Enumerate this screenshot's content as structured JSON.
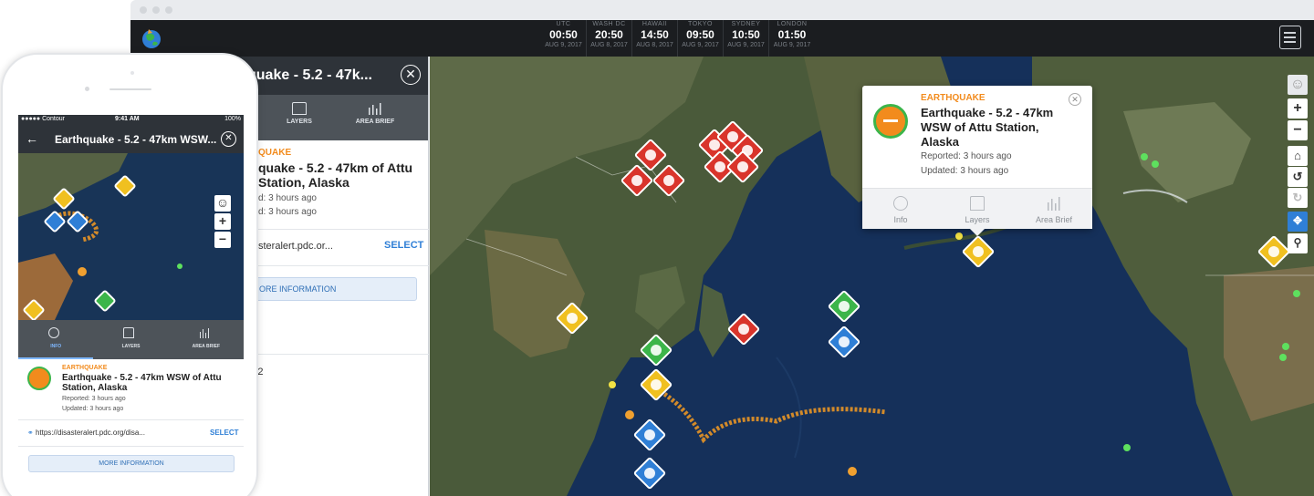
{
  "window": {
    "time_zones": [
      {
        "zone": "UTC",
        "time": "00:50",
        "date": "AUG 9, 2017"
      },
      {
        "zone": "WASH DC",
        "time": "20:50",
        "date": "AUG 8, 2017"
      },
      {
        "zone": "HAWAII",
        "time": "14:50",
        "date": "AUG 8, 2017"
      },
      {
        "zone": "TOKYO",
        "time": "09:50",
        "date": "AUG 9, 2017"
      },
      {
        "zone": "SYDNEY",
        "time": "10:50",
        "date": "AUG 9, 2017"
      },
      {
        "zone": "LONDON",
        "time": "01:50",
        "date": "AUG 9, 2017"
      }
    ]
  },
  "side_panel": {
    "title": "quake - 5.2 - 47k...",
    "tabs": [
      "LAYERS",
      "AREA BRIEF"
    ],
    "category": "QUAKE",
    "event_title": "quake - 5.2 - 47km of Attu Station, Alaska",
    "reported": "d: 3 hours ago",
    "updated": "d: 3 hours ago",
    "url": "steralert.pdc.or...",
    "select_label": "SELECT",
    "more_label": "ORE INFORMATION",
    "extra": "P2"
  },
  "popup": {
    "category": "EARTHQUAKE",
    "title": "Earthquake - 5.2 - 47km WSW of Attu Station, Alaska",
    "reported": "Reported: 3 hours ago",
    "updated": "Updated: 3 hours ago",
    "tabs": [
      "Info",
      "Layers",
      "Area Brief"
    ]
  },
  "map_controls": [
    "person-icon",
    "zoom-in",
    "zoom-out",
    "home-icon",
    "rotate-icon",
    "refresh-icon",
    "pan-icon",
    "search-zoom-icon"
  ],
  "phone": {
    "status_left": "●●●●● Contour",
    "status_time": "9:41 AM",
    "status_right": "100%",
    "header_title": "Earthquake - 5.2 - 47km WSW...",
    "tabs": [
      "INFO",
      "LAYERS",
      "AREA BRIEF"
    ],
    "category": "EARTHQUAKE",
    "title": "Earthquake - 5.2 - 47km WSW of Attu Station, Alaska",
    "reported": "Reported: 3 hours ago",
    "updated": "Updated: 3 hours ago",
    "link": "https://disasteralert.pdc.org/disa...",
    "select_label": "SELECT",
    "more_label": "MORE INFORMATION"
  },
  "colors": {
    "accent": "#2f7fd6",
    "alert_orange": "#f28b1d",
    "header_dark": "#2e3339"
  }
}
